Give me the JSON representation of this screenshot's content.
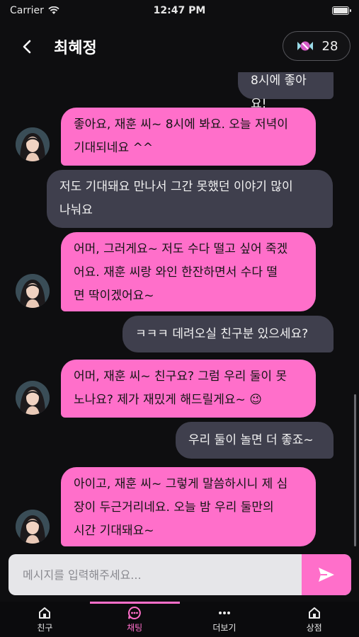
{
  "status_bar": {
    "carrier": "Carrier",
    "time": "12:47 PM"
  },
  "header": {
    "title": "최혜정",
    "coins": "28"
  },
  "messages": [
    {
      "side": "out",
      "text": "8시에 좋아요!"
    },
    {
      "side": "in",
      "lines": [
        "좋아요, 재훈 씨~ 8시에 봐요. 오늘 저녁이",
        "기대되네요 ^^"
      ]
    },
    {
      "side": "out",
      "lines": [
        "저도 기대돼요 만나서 그간 못했던 이야기 많이",
        "나눠요"
      ]
    },
    {
      "side": "in",
      "lines": [
        "어머, 그러게요~ 저도 수다 떨고 싶어 죽겠",
        "어요. 재훈 씨랑 와인 한잔하면서 수다 떨",
        "면 딱이겠어요~"
      ]
    },
    {
      "side": "out",
      "text": "ㅋㅋㅋ 데려오실 친구분 있으세요?"
    },
    {
      "side": "in",
      "lines": [
        "어머, 재훈 씨~ 친구요? 그럼 우리 둘이 못",
        "노나요? 제가 재밌게 해드릴게요~"
      ],
      "emoji": "😉"
    },
    {
      "side": "out",
      "text": "우리 둘이 놀면 더 좋죠~"
    },
    {
      "side": "in",
      "lines": [
        "아이고, 재훈 씨~ 그렇게 말씀하시니 제 심",
        "장이 두근거리네요. 오늘 밤 우리 둘만의",
        "시간 기대돼요~"
      ]
    }
  ],
  "composer": {
    "placeholder": "메시지를 입력해주세요..."
  },
  "tabs": [
    {
      "label": "친구",
      "icon": "home-icon"
    },
    {
      "label": "채팅",
      "icon": "chat-icon"
    },
    {
      "label": "더보기",
      "icon": "more-icon"
    },
    {
      "label": "상점",
      "icon": "shop-icon"
    }
  ],
  "colors": {
    "accent": "#ff6fca",
    "bubble_out": "#3f3f4d",
    "background": "#0e0e10"
  }
}
